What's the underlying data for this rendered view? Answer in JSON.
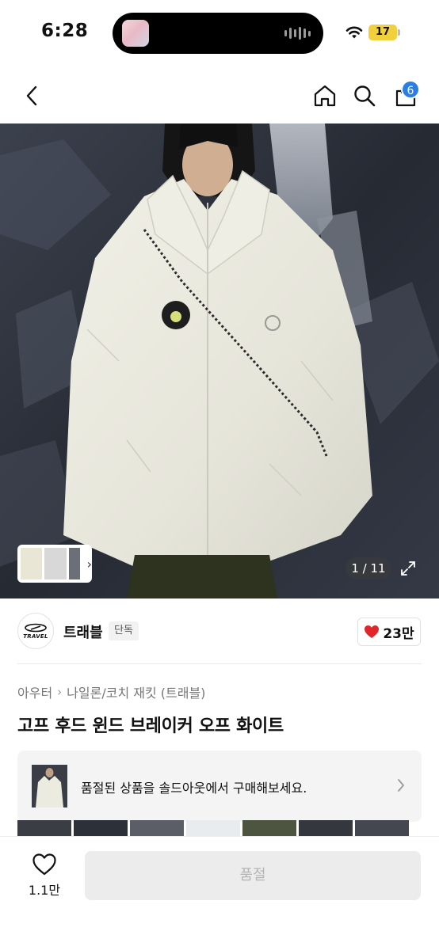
{
  "status_bar": {
    "time": "6:28",
    "battery": "17",
    "battery_color": "#f2d03c"
  },
  "nav": {
    "back_icon": "chevron-left-icon",
    "home_icon": "home-icon",
    "search_icon": "search-icon",
    "cart_icon": "bag-icon",
    "cart_count": "6",
    "badge_color": "#2a7de1"
  },
  "gallery": {
    "page_indicator": "1 / 11",
    "expand_icon": "expand-icon"
  },
  "brand": {
    "logo_text": "TRAVEL",
    "name": "트래블",
    "tag": "단독",
    "likes": "23만",
    "heart_color": "#e0262b"
  },
  "product": {
    "breadcrumb": [
      "아우터",
      "나일론/코치 재킷 (트래블)"
    ],
    "title": "고프 후드 윈드 브레이커 오프 화이트"
  },
  "soldout_banner": {
    "text": "품절된 상품을 솔드아웃에서 구매해보세요."
  },
  "bottom_bar": {
    "wish_count": "1.1만",
    "buy_label": "품절"
  }
}
